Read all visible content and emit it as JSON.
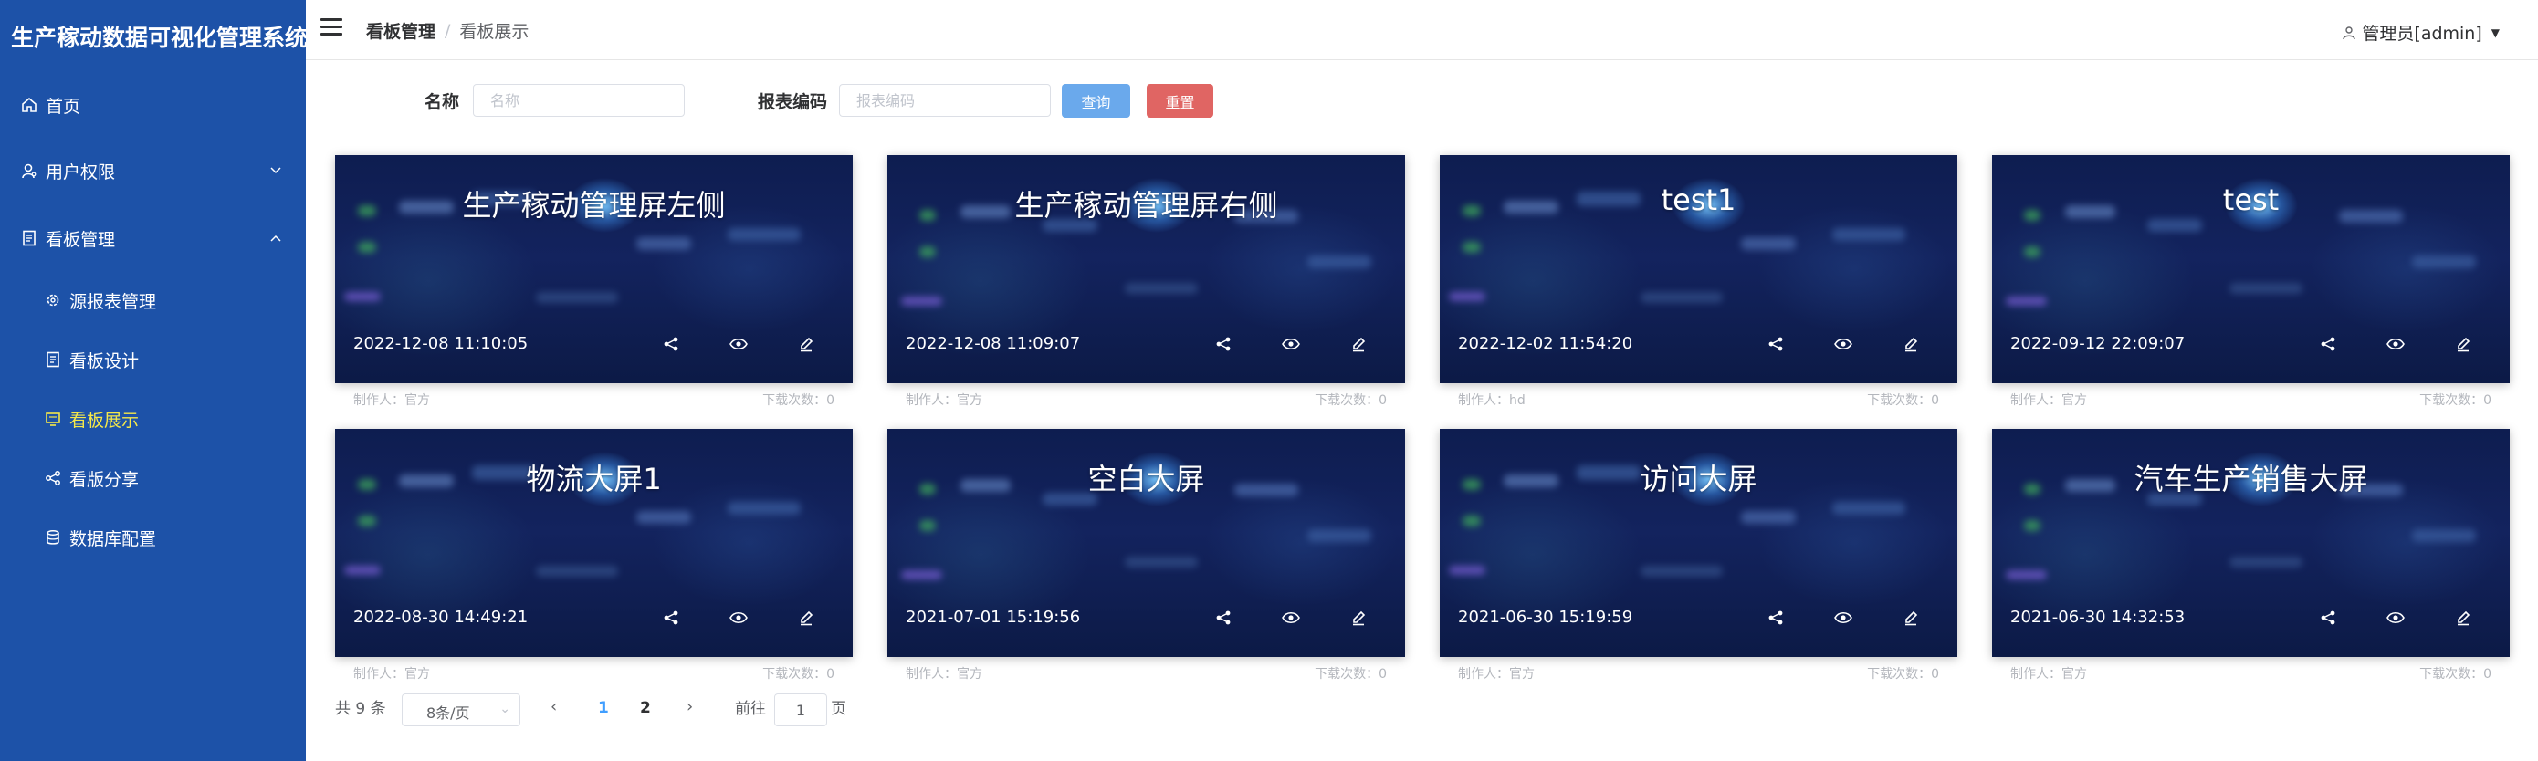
{
  "app": {
    "title": "生产稼动数据可视化管理系统"
  },
  "sidebar": {
    "items": [
      {
        "label": "首页"
      },
      {
        "label": "用户权限"
      },
      {
        "label": "看板管理"
      }
    ],
    "subitems": [
      {
        "label": "源报表管理"
      },
      {
        "label": "看板设计"
      },
      {
        "label": "看板展示"
      },
      {
        "label": "看版分享"
      },
      {
        "label": "数据库配置"
      }
    ],
    "active_color": "#f5e84a",
    "background": "#1d52a8"
  },
  "header": {
    "breadcrumb": [
      "看板管理",
      "看板展示"
    ],
    "user": "管理员[admin]"
  },
  "search": {
    "name_label": "名称",
    "name_placeholder": "名称",
    "code_label": "报表编码",
    "code_placeholder": "报表编码",
    "query_label": "查询",
    "reset_label": "重置"
  },
  "cards": [
    {
      "title": "生产稼动管理屏左侧",
      "time": "2022-12-08 11:10:05",
      "maker_label": "制作人：",
      "maker": "官方",
      "downloads_label": "下载次数：",
      "downloads": "0"
    },
    {
      "title": "生产稼动管理屏右侧",
      "time": "2022-12-08 11:09:07",
      "maker_label": "制作人：",
      "maker": "官方",
      "downloads_label": "下载次数：",
      "downloads": "0"
    },
    {
      "title": "test1",
      "time": "2022-12-02 11:54:20",
      "maker_label": "制作人：",
      "maker": "hd",
      "downloads_label": "下载次数：",
      "downloads": "0"
    },
    {
      "title": "test",
      "time": "2022-09-12 22:09:07",
      "maker_label": "制作人：",
      "maker": "官方",
      "downloads_label": "下载次数：",
      "downloads": "0"
    },
    {
      "title": "物流大屏1",
      "time": "2022-08-30 14:49:21",
      "maker_label": "制作人：",
      "maker": "官方",
      "downloads_label": "下载次数：",
      "downloads": "0"
    },
    {
      "title": "空白大屏",
      "time": "2021-07-01 15:19:56",
      "maker_label": "制作人：",
      "maker": "官方",
      "downloads_label": "下载次数：",
      "downloads": "0"
    },
    {
      "title": "访问大屏",
      "time": "2021-06-30 15:19:59",
      "maker_label": "制作人：",
      "maker": "官方",
      "downloads_label": "下载次数：",
      "downloads": "0"
    },
    {
      "title": "汽车生产销售大屏",
      "time": "2021-06-30 14:32:53",
      "maker_label": "制作人：",
      "maker": "官方",
      "downloads_label": "下载次数：",
      "downloads": "0"
    }
  ],
  "pagination": {
    "total": "共 9 条",
    "page_size": "8条/页",
    "pages": [
      "1",
      "2"
    ],
    "current_page": "1",
    "goto_prefix": "前往",
    "goto_value": "1",
    "goto_suffix": "页"
  }
}
